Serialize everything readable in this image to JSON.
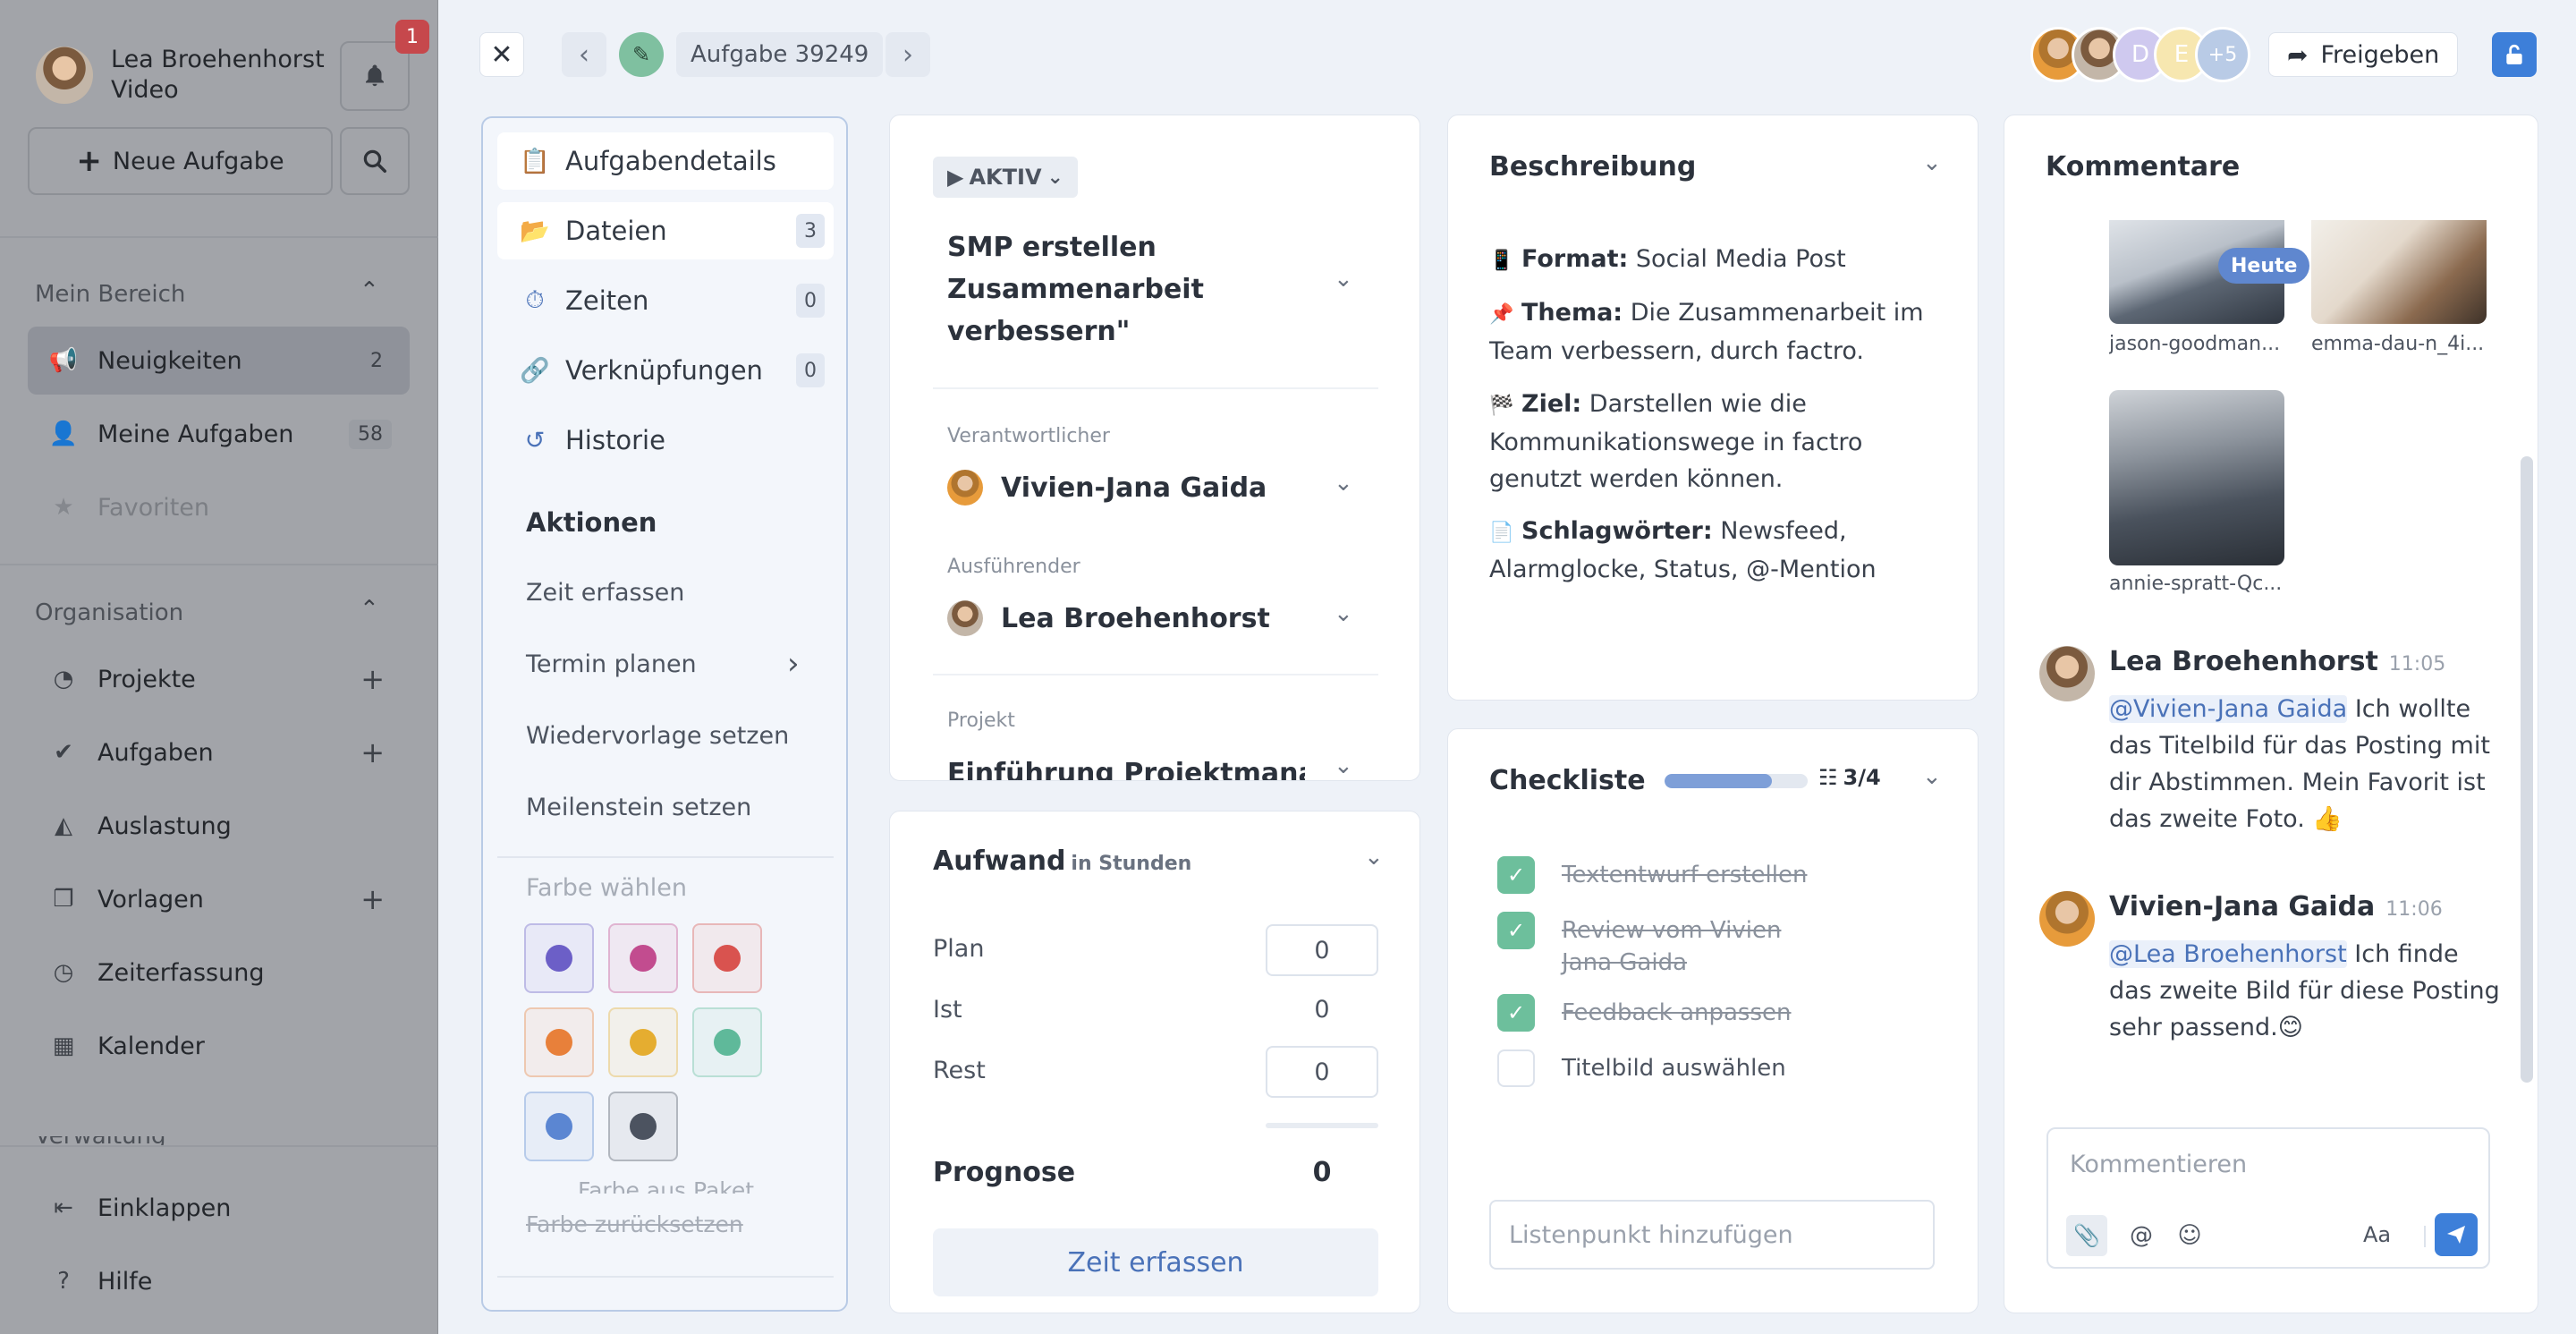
{
  "sidebar": {
    "user_name": "Lea Broehenhorst",
    "user_sub": "Video",
    "notifications_count": "1",
    "new_task_label": "Neue Aufgabe",
    "section_mine": "Mein Bereich",
    "section_org": "Organisation",
    "section_partial": "Verwaltung",
    "items_mine": [
      {
        "label": "Neuigkeiten",
        "count": "2"
      },
      {
        "label": "Meine Aufgaben",
        "count": "58"
      },
      {
        "label": "Favoriten"
      }
    ],
    "items_org": [
      {
        "label": "Projekte"
      },
      {
        "label": "Aufgaben"
      },
      {
        "label": "Auslastung"
      },
      {
        "label": "Vorlagen"
      },
      {
        "label": "Zeiterfassung"
      },
      {
        "label": "Kalender"
      }
    ],
    "collapse_label": "Einklappen",
    "help_label": "Hilfe"
  },
  "header": {
    "task_id": "Aufgabe 39249",
    "avatar_d": "D",
    "avatar_e": "E",
    "more_count": "+5",
    "share_label": "Freigeben"
  },
  "nav": {
    "items": [
      {
        "label": "Aufgabendetails"
      },
      {
        "label": "Dateien",
        "count": "3"
      },
      {
        "label": "Zeiten",
        "count": "0"
      },
      {
        "label": "Verknüpfungen",
        "count": "0"
      },
      {
        "label": "Historie"
      }
    ],
    "actions_title": "Aktionen",
    "actions": [
      "Zeit erfassen",
      "Termin planen",
      "Wiedervorlage setzen",
      "Meilenstein setzen"
    ],
    "color_title": "Farbe wählen",
    "colors": [
      "#6c5fc7",
      "#c24c8f",
      "#d9534f",
      "#e8803a",
      "#e5ad30",
      "#5fb99a",
      "#5b86d2",
      "#4c5360"
    ],
    "color_from_package": "Farbe aus Paket",
    "color_reset": "Farbe zurücksetzen"
  },
  "task": {
    "status": "AKTIV",
    "title": "SMP erstellen Zusammenarbeit verbessern\"",
    "responsible_label": "Verantwortlicher",
    "responsible": "Vivien-Jana Gaida",
    "executor_label": "Ausführender",
    "executor": "Lea Broehenhorst",
    "project_label": "Projekt",
    "project": "Einführung Projektmanagement"
  },
  "effort": {
    "title": "Aufwand",
    "unit": "in Stunden",
    "plan_label": "Plan",
    "plan": "0",
    "ist_label": "Ist",
    "ist": "0",
    "rest_label": "Rest",
    "rest": "0",
    "forecast_label": "Prognose",
    "forecast": "0",
    "button": "Zeit erfassen"
  },
  "description": {
    "title": "Beschreibung",
    "format_label": "Format:",
    "format": "Social Media Post",
    "theme_label": "Thema:",
    "theme": "Die Zusammenarbeit im Team verbessern, durch factro.",
    "goal_label": "Ziel:",
    "goal": "Darstellen wie die Kommunikationswege in factro genutzt werden können.",
    "keywords_label": "Schlagwörter:",
    "keywords": "Newsfeed, Alarmglocke, Status, @-Mention"
  },
  "checklist": {
    "title": "Checkliste",
    "progress_fraction": 0.75,
    "count": "3/4",
    "items": [
      {
        "label": "Textentwurf erstellen",
        "done": true
      },
      {
        "label": "Review vom Vivien Jana Gaida",
        "done": true
      },
      {
        "label": "Feedback anpassen",
        "done": true
      },
      {
        "label": "Titelbild auswählen",
        "done": false
      }
    ],
    "add_placeholder": "Listenpunkt hinzufügen"
  },
  "comments": {
    "title": "Kommentare",
    "today_badge": "Heute",
    "files": [
      "jason-goodman...",
      "emma-dau-n_4i...",
      "annie-spratt-Qc..."
    ],
    "entries": [
      {
        "author": "Lea Broehenhorst",
        "time": "11:05",
        "mention": "@Vivien-Jana Gaida",
        "text": "Ich wollte das Titelbild für das Posting mit dir Abstimmen. Mein Favorit ist das zweite Foto. 👍"
      },
      {
        "author": "Vivien-Jana Gaida",
        "time": "11:06",
        "mention": "@Lea Broehenhorst",
        "text": "Ich finde das zweite Bild für diese Posting sehr passend.😊"
      }
    ],
    "input_placeholder": "Kommentieren",
    "format_label": "Aa"
  }
}
